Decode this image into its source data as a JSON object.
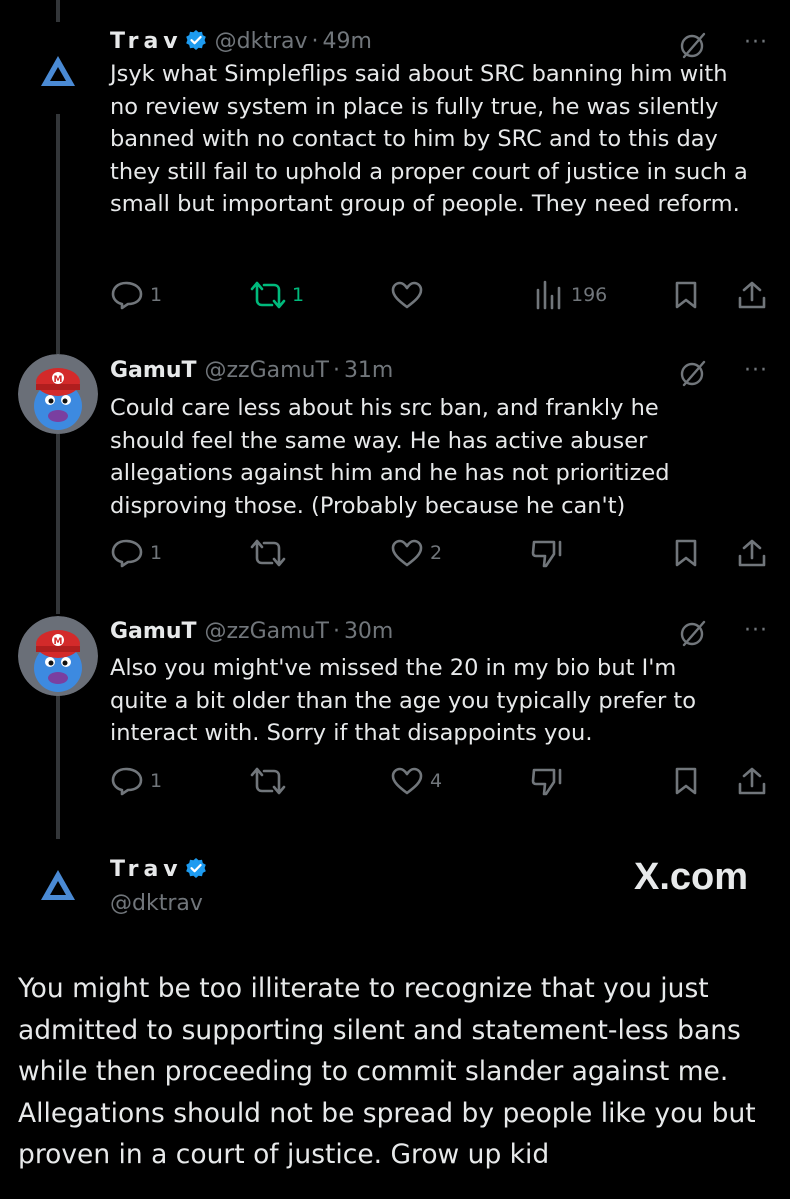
{
  "tweets": [
    {
      "name": "Trav",
      "handle": "@dktrav",
      "time": "49m",
      "verified": true,
      "avatar_icon": "triangle-logo-icon",
      "text": "Jsyk what Simpleflips said about SRC banning him with no review system in place is fully true, he was silently banned with no contact to him by SRC and to this day they still fail to uphold a proper court of justice in such a small but important group of people. They need reform.",
      "replies": "1",
      "retweets": "1",
      "retweeted": true,
      "likes": "",
      "views": "196"
    },
    {
      "name": "GamuT",
      "handle": "@zzGamuT",
      "time": "31m",
      "verified": false,
      "avatar_icon": "mario-cap-mascot-icon",
      "text": "Could care less about his src ban, and frankly he should feel the same way. He has active abuser allegations against him and he has not prioritized disproving those. (Probably because he can't)",
      "replies": "1",
      "retweets": "",
      "likes": "2"
    },
    {
      "name": "GamuT",
      "handle": "@zzGamuT",
      "time": "30m",
      "verified": false,
      "avatar_icon": "mario-cap-mascot-icon",
      "text": "Also you might've missed the 20 in my bio but I'm quite a bit older than the age you typically prefer to interact with. Sorry if that disappoints you.",
      "replies": "1",
      "retweets": "",
      "likes": "4"
    }
  ],
  "quote": {
    "name": "Trav",
    "handle": "@dktrav",
    "verified": true,
    "watermark": "X.com",
    "text": "You might be too illiterate to recognize that you just admitted to supporting silent and statement-less bans while then proceeding to commit slander against me. Allegations should not be spread by people like you but proven in a court of justice. Grow up kid"
  },
  "colors": {
    "background": "#000000",
    "text": "#e7e9ea",
    "muted": "#71767b",
    "verified": "#1d9bf0",
    "retweet_active": "#00ba7c",
    "thread_line": "#333639"
  }
}
